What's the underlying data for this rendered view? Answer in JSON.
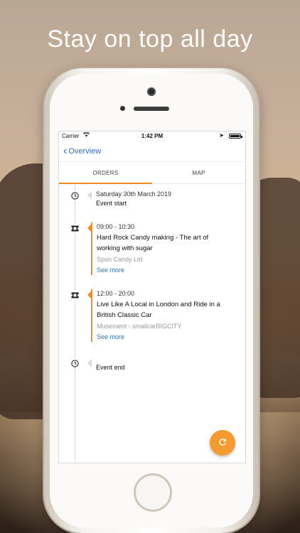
{
  "tagline": "Stay on top all day",
  "status_bar": {
    "carrier": "Carrier",
    "time": "1:42 PM"
  },
  "nav": {
    "back_label": "Overview"
  },
  "tabs": [
    {
      "label": "ORDERS",
      "active": true
    },
    {
      "label": "MAP",
      "active": false
    }
  ],
  "timeline": [
    {
      "type": "marker",
      "icon": "clock-icon",
      "date": "Saturday 30th March 2019",
      "label": "Event start"
    },
    {
      "type": "order",
      "icon": "ticket-icon",
      "time": "09:00 - 10:30",
      "title_line1": "Hard Rock Candy making - The art of",
      "title_line2": "working with sugar",
      "provider": "Spun Candy Ltd",
      "link": "See more"
    },
    {
      "type": "order",
      "icon": "ticket-icon",
      "time": "12:00 - 20:00",
      "title_line1": "Live Like A Local in London and Ride in a",
      "title_line2": "British Classic Car",
      "provider": "Musement - smallcarBIGCITY",
      "link": "See more"
    },
    {
      "type": "marker",
      "icon": "clock-icon",
      "label": "Event end"
    }
  ],
  "fab": {
    "icon": "refresh-icon"
  },
  "colors": {
    "accent": "#f08a24",
    "link": "#2d6fb0",
    "fab": "#f39a33"
  }
}
